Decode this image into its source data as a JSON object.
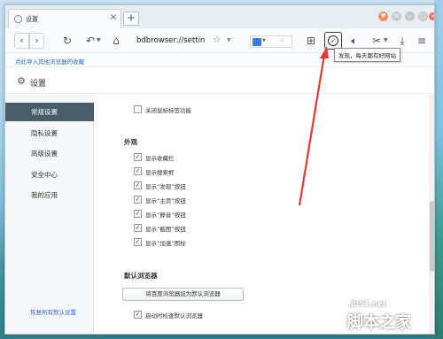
{
  "tab": {
    "title": "设置",
    "close": "×",
    "new_tab": "+"
  },
  "toolbar": {
    "back": "‹",
    "forward": "›",
    "refresh": "↻",
    "undo": "↶",
    "home": "⌂",
    "url": "bdbrowser://settin",
    "tooltip": "发现，每天都有好网站"
  },
  "bookmarks": {
    "import_link": "点此导入其他浏览器的收藏"
  },
  "settings": {
    "title": "设置",
    "icon": "gear-icon"
  },
  "sidebar": {
    "items": [
      {
        "label": "常规设置",
        "active": true
      },
      {
        "label": "隐私设置"
      },
      {
        "label": "高级设置"
      },
      {
        "label": "安全中心"
      },
      {
        "label": "我的应用"
      }
    ],
    "restore_link": "恢复所有默认设置"
  },
  "content": {
    "top_option": "关闭鼠标标签功能",
    "appearance": {
      "title": "外观",
      "options": [
        "显示收藏栏",
        "显示搜索框",
        "显示“发现”按钮",
        "显示“主页”按钮",
        "显示“静音”按钮",
        "显示“截图”按钮",
        "显示“加速”图标"
      ]
    },
    "default_browser": {
      "title": "默认浏览器",
      "button": "将百度浏览器设为默认浏览器",
      "option": "启动时检查默认浏览器"
    }
  },
  "watermark": {
    "line1": "jb51.net",
    "line2": "脚本之家"
  },
  "colors": {
    "accent_link": "#2d6bd1",
    "sidebar_active": "#4a5d6b",
    "arrow": "#e53935"
  }
}
